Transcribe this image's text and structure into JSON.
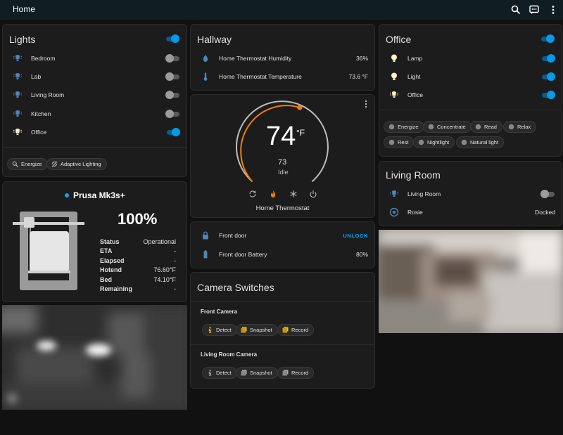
{
  "header": {
    "title": "Home"
  },
  "lights": {
    "title": "Lights",
    "items": [
      {
        "label": "Bedroom",
        "on": false
      },
      {
        "label": "Lab",
        "on": false
      },
      {
        "label": "Living Room",
        "on": false
      },
      {
        "label": "Kitchen",
        "on": false
      },
      {
        "label": "Office",
        "on": true
      }
    ],
    "chips": [
      "Energize",
      "Adaptive Lighting"
    ]
  },
  "hallway": {
    "title": "Hallway",
    "rows": [
      {
        "label": "Home Thermostat Humidity",
        "value": "36%"
      },
      {
        "label": "Home Thermostat Temperature",
        "value": "73.6 °F"
      }
    ]
  },
  "thermostat": {
    "temperature": "74",
    "unit": "°F",
    "target": "73",
    "mode": "Idle",
    "name": "Home Thermostat",
    "colors": {
      "heat": "#f57c00",
      "arc": "#cfcfcf"
    }
  },
  "lock": {
    "rows": [
      {
        "label": "Front door",
        "value": "UNLOCK"
      },
      {
        "label": "Front door Battery",
        "value": "80%"
      }
    ]
  },
  "camera_switches": {
    "title": "Camera Switches",
    "groups": [
      {
        "name": "Front Camera",
        "buttons": [
          "Detect",
          "Snapshot",
          "Record"
        ]
      },
      {
        "name": "Living Room Camera",
        "buttons": [
          "Detect",
          "Snapshot",
          "Record"
        ]
      }
    ]
  },
  "office": {
    "title": "Office",
    "items": [
      {
        "label": "Lamp",
        "on": true
      },
      {
        "label": "Light",
        "on": true
      },
      {
        "label": "Office",
        "on": true
      }
    ],
    "scenes": [
      "Energize",
      "Concentrate",
      "Read",
      "Relax",
      "Rest",
      "Nightlight",
      "Natural light"
    ]
  },
  "living_room": {
    "title": "Living Room",
    "rows": [
      {
        "label": "Living Room",
        "on": false
      },
      {
        "label": "Rosie",
        "value": "Docked"
      }
    ]
  },
  "prusa": {
    "name": "Prusa Mk3s+",
    "progress": "100%",
    "status_color": "#03a9f4",
    "stats": [
      {
        "key": "Status",
        "value": "Operational"
      },
      {
        "key": "ETA",
        "value": "-"
      },
      {
        "key": "Elapsed",
        "value": "-"
      },
      {
        "key": "Hotend",
        "value": "76.60°F"
      },
      {
        "key": "Bed",
        "value": "74.10°F"
      },
      {
        "key": "Remaining",
        "value": "-"
      }
    ]
  },
  "theme": {
    "accent": "#039be5",
    "background": "#111111",
    "card": "#1c1c1c"
  }
}
